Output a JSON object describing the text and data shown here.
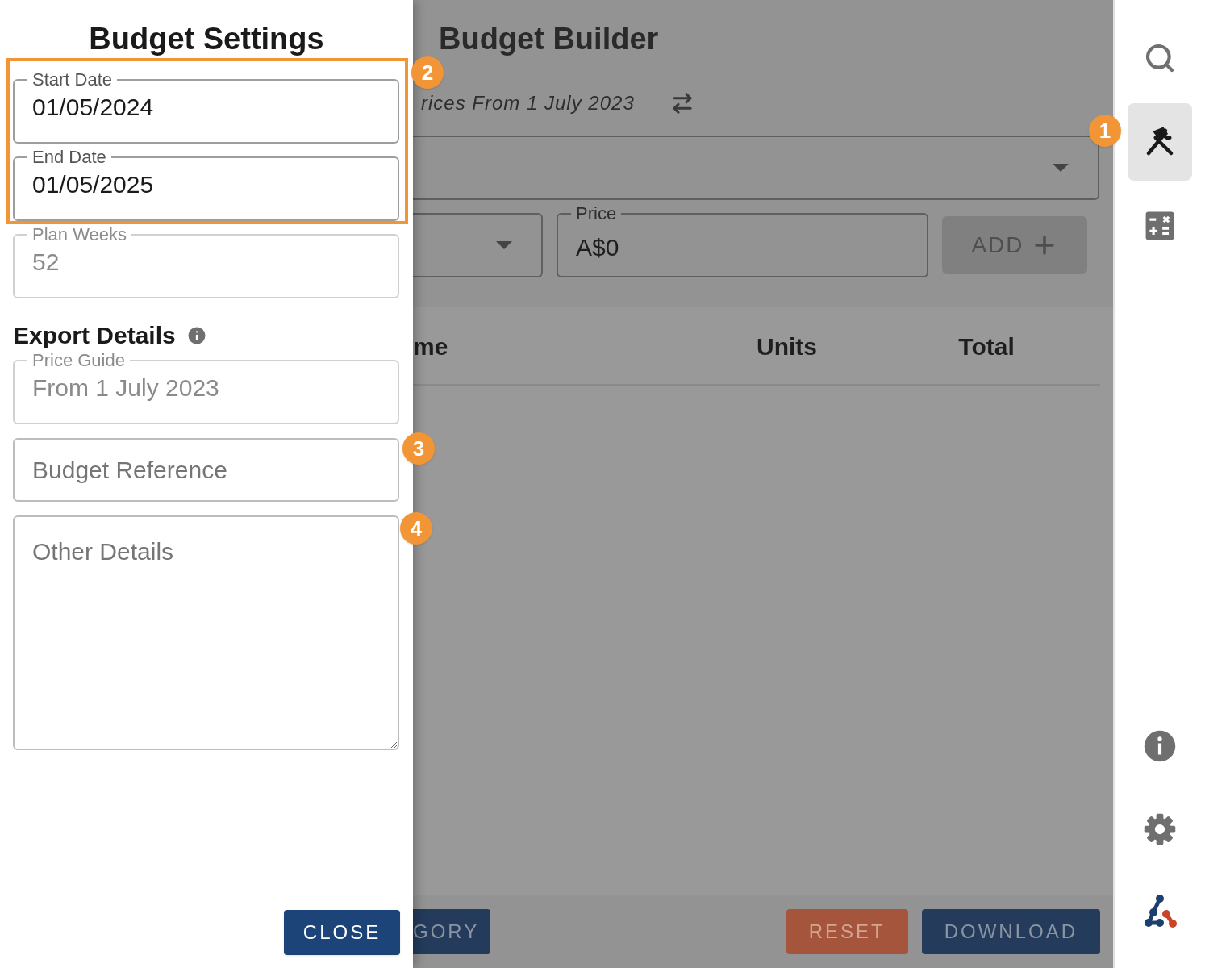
{
  "drawer": {
    "title": "Budget Settings",
    "fields": [
      {
        "label": "Start Date",
        "value": "01/05/2024",
        "disabled": false
      },
      {
        "label": "End Date",
        "value": "01/05/2025",
        "disabled": false
      },
      {
        "label": "Plan Weeks",
        "value": "52",
        "disabled": true
      }
    ],
    "export_heading": "Export Details",
    "export_fields": [
      {
        "kind": "value",
        "label": "Price Guide",
        "value": "From 1 July 2023",
        "disabled": true
      },
      {
        "kind": "input",
        "placeholder": "Budget Reference",
        "disabled": false
      },
      {
        "kind": "textarea",
        "placeholder": "Other Details",
        "disabled": false
      }
    ],
    "close_button": "CLOSE"
  },
  "main": {
    "title": "Budget Builder",
    "subtitle": "rices From 1 July 2023",
    "price": {
      "label": "Price",
      "value": "A$0"
    },
    "add_button": {
      "label": "ADD",
      "disabled": true
    },
    "columns": [
      "me",
      "Units",
      "Total"
    ],
    "buttons": [
      {
        "label": "GORY",
        "kind": "primary"
      },
      {
        "label": "RESET",
        "kind": "danger"
      },
      {
        "label": "DOWNLOAD",
        "kind": "primary"
      }
    ]
  },
  "sidebar": {
    "items": [
      {
        "kind": "search",
        "selected": false
      },
      {
        "kind": "tools",
        "selected": true
      },
      {
        "kind": "calculator",
        "selected": false
      },
      {
        "kind": "info",
        "selected": false
      },
      {
        "kind": "settings",
        "selected": false
      },
      {
        "kind": "logo",
        "selected": false
      }
    ]
  },
  "annotations": [
    {
      "label": "1"
    },
    {
      "label": "2"
    },
    {
      "label": "3"
    },
    {
      "label": "4"
    }
  ]
}
